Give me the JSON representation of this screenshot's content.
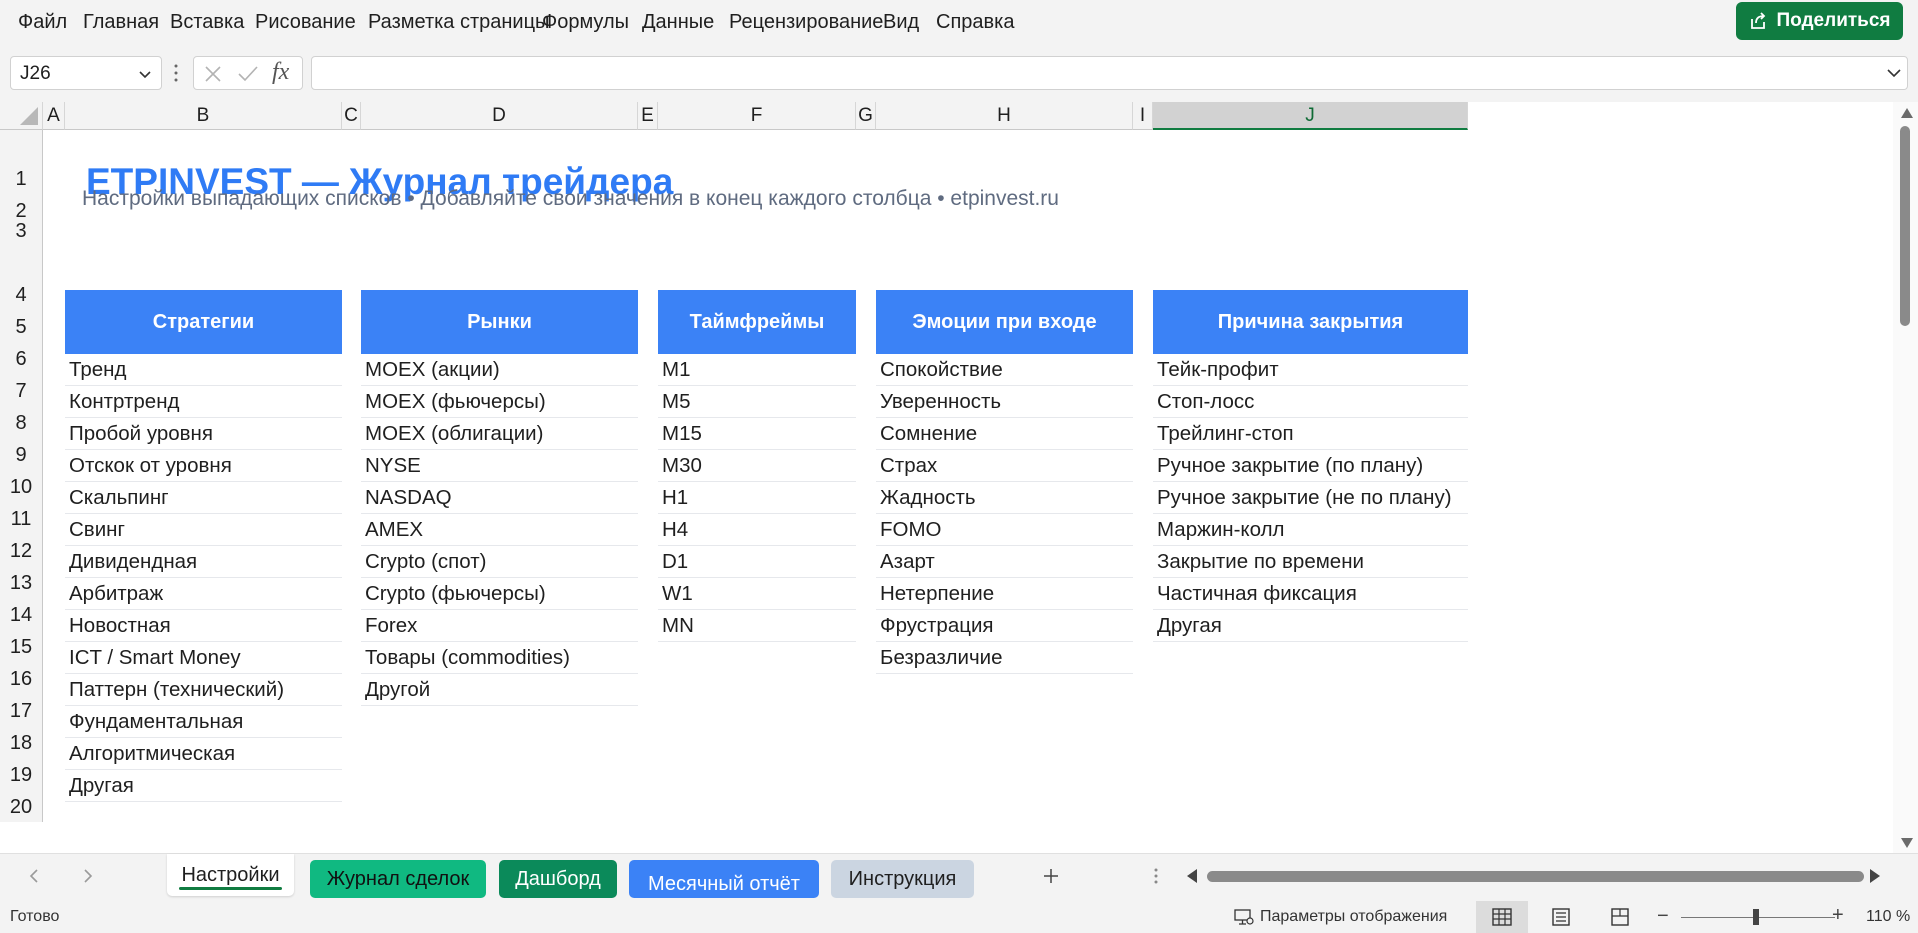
{
  "menu": {
    "items": [
      "Файл",
      "Главная",
      "Вставка",
      "Рисование",
      "Разметка страницы",
      "Формулы",
      "Данные",
      "Рецензирование",
      "Вид",
      "Справка"
    ],
    "share_label": "Поделиться",
    "share_icon": "share-icon"
  },
  "formula_bar": {
    "name_box": "J26",
    "fx_label": "fx",
    "formula": ""
  },
  "grid": {
    "columns": [
      "A",
      "B",
      "C",
      "D",
      "E",
      "F",
      "G",
      "H",
      "I",
      "J"
    ],
    "selected_column": "J",
    "rows": [
      "1",
      "2",
      "3",
      "4",
      "5",
      "6",
      "7",
      "8",
      "9",
      "10",
      "11",
      "12",
      "13",
      "14",
      "15",
      "16",
      "17",
      "18",
      "19",
      "20"
    ],
    "title": "ETPINVEST — Журнал трейдера",
    "subtitle": "Настройки выпадающих списков  •  Добавляйте свои значения в конец каждого столбца  •  etpinvest.ru",
    "accent_color": "#3b82f6",
    "title_color": "#2f7bf5",
    "tables": [
      {
        "header": "Стратегии",
        "items": [
          "Тренд",
          "Контртренд",
          "Пробой уровня",
          "Отскок от уровня",
          "Скальпинг",
          "Свинг",
          "Дивидендная",
          "Арбитраж",
          "Новостная",
          "ICT / Smart Money",
          "Паттерн (технический)",
          "Фундаментальная",
          "Алгоритмическая",
          "Другая"
        ]
      },
      {
        "header": "Рынки",
        "items": [
          "MOEX (акции)",
          "MOEX (фьючерсы)",
          "MOEX (облигации)",
          "NYSE",
          "NASDAQ",
          "AMEX",
          "Crypto (спот)",
          "Crypto (фьючерсы)",
          "Forex",
          "Товары (commodities)",
          "Другой"
        ]
      },
      {
        "header": "Таймфреймы",
        "items": [
          "M1",
          "M5",
          "M15",
          "M30",
          "H1",
          "H4",
          "D1",
          "W1",
          "MN"
        ]
      },
      {
        "header": "Эмоции при входе",
        "items": [
          "Спокойствие",
          "Уверенность",
          "Сомнение",
          "Страх",
          "Жадность",
          "FOMO",
          "Азарт",
          "Нетерпение",
          "Фрустрация",
          "Безразличие"
        ]
      },
      {
        "header": "Причина закрытия",
        "items": [
          "Тейк-профит",
          "Стоп-лосс",
          "Трейлинг-стоп",
          "Ручное закрытие (по плану)",
          "Ручное закрытие (не по плану)",
          "Маржин-колл",
          "Закрытие по времени",
          "Частичная фиксация",
          "Другая"
        ]
      }
    ]
  },
  "sheets": {
    "tabs": [
      "Настройки",
      "Журнал сделок",
      "Дашборд",
      "Месячный отчёт",
      "Инструкция"
    ],
    "active": "Настройки",
    "colors": {
      "journal": "#10b981",
      "dashboard": "#0b8a5a",
      "monthly": "#3b82f6",
      "instructions": "#cbd5e1"
    }
  },
  "status": {
    "ready": "Готово",
    "display_settings": "Параметры отображения",
    "zoom": "110 %",
    "zoom_percent": 110
  }
}
